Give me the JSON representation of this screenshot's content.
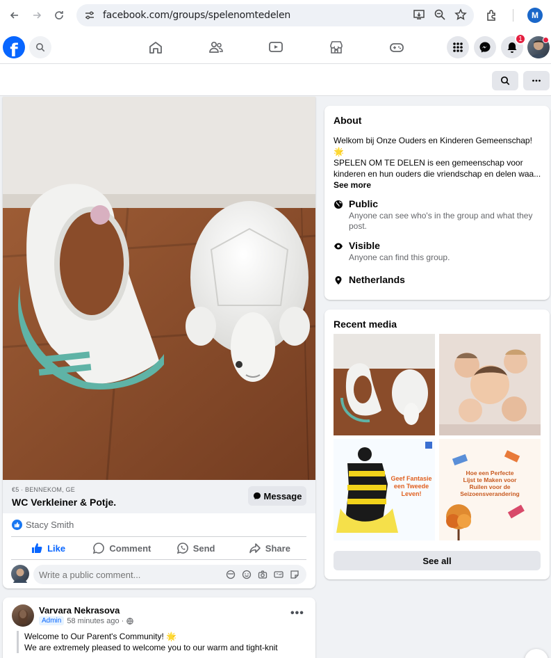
{
  "browser": {
    "url": "facebook.com/groups/spelenomtedelen",
    "profile_initial": "M"
  },
  "fb_nav": {
    "logo_letter": "f",
    "notification_count": "1"
  },
  "post": {
    "price_location": "€5 · BENNEKOM, GE",
    "title": "WC Verkleiner & Potje.",
    "message_label": "Message",
    "reaction_name": "Stacy Smith",
    "actions": {
      "like": "Like",
      "comment": "Comment",
      "send": "Send",
      "share": "Share"
    },
    "comment_placeholder": "Write a public comment..."
  },
  "post2": {
    "author": "Varvara Nekrasova",
    "badge": "Admin",
    "time": "58 minutes ago ·",
    "line1": "Welcome to Our Parent's Community! 🌟",
    "line2": "We are extremely pleased to welcome you to our warm and tight-knit"
  },
  "about": {
    "title": "About",
    "desc_line1": "Welkom bij Onze Ouders en Kinderen Gemeenschap!",
    "desc_line2": "🌟",
    "desc_line3": "SPELEN OM TE DELEN is een gemeenschap voor",
    "desc_line4": "kinderen en hun ouders die vriendschap en delen waa...",
    "see_more": "See more",
    "privacy_title": "Public",
    "privacy_sub": "Anyone can see who's in the group and what they post.",
    "visibility_title": "Visible",
    "visibility_sub": "Anyone can find this group.",
    "location": "Netherlands"
  },
  "media": {
    "title": "Recent media",
    "see_all": "See all",
    "tile3_text": "Geef Fantasie een Tweede Leven!",
    "tile4_text": "Hoe een Perfecte Lijst te Maken voor Ruilen voor de Seizoensverandering"
  },
  "colors": {
    "accent": "#0866ff",
    "background": "#f0f2f5",
    "badge_red": "#e41e3f"
  },
  "icons": [
    "back-arrow-icon",
    "forward-arrow-icon",
    "reload-icon",
    "site-settings-icon",
    "install-app-icon",
    "zoom-icon",
    "star-icon",
    "extensions-icon",
    "home-icon",
    "friends-icon",
    "video-icon",
    "marketplace-icon",
    "gaming-icon",
    "menu-grid-icon",
    "messenger-icon",
    "bell-icon",
    "search-icon",
    "more-icon",
    "globe-icon",
    "eye-icon",
    "location-pin-icon"
  ]
}
